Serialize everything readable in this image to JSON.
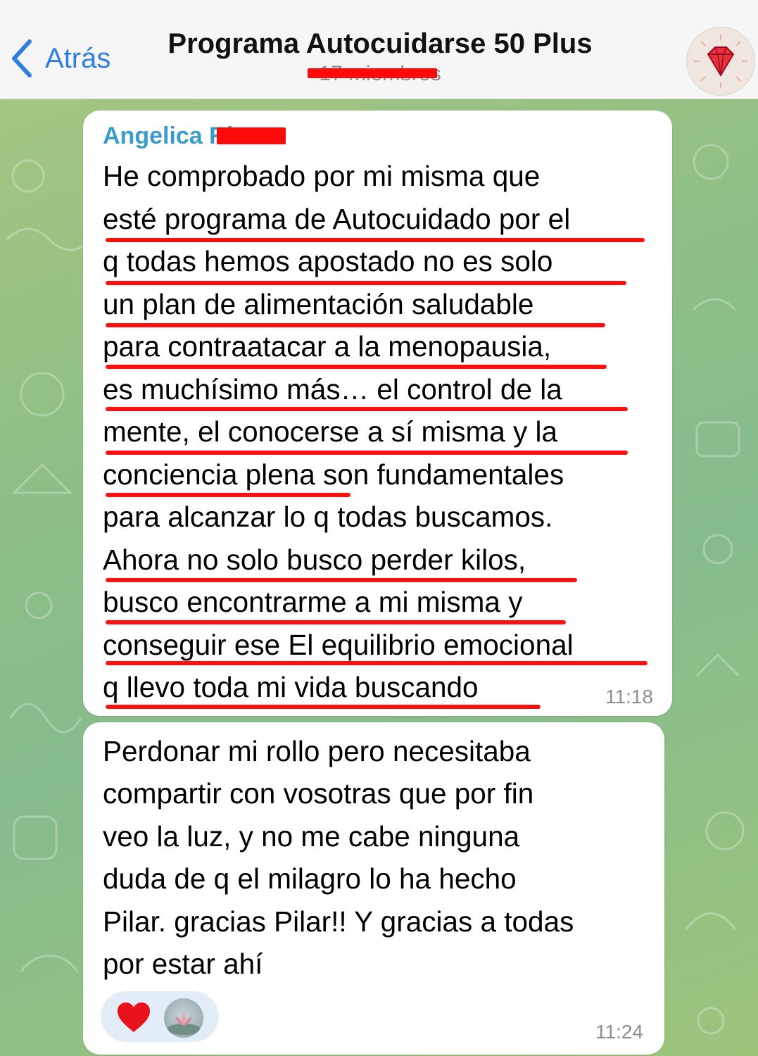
{
  "header": {
    "back_label": "Atrás",
    "title": "Programa Autocuidarse 50 Plus",
    "subtitle": "17 miembros",
    "avatar_icon": "ruby-gem-icon"
  },
  "messages": [
    {
      "sender": "Angelica Rivas",
      "lines": [
        "He comprobado por mi misma que",
        "esté programa de Autocuidado por el",
        "q todas hemos apostado no es solo",
        "un plan de alimentación saludable",
        "para contraatacar a la menopausia,",
        "es muchísimo más… el control de la",
        "mente, el conocerse a sí misma y la",
        "conciencia plena son fundamentales",
        "para alcanzar lo q todas buscamos.",
        "Ahora no solo busco perder kilos,",
        "busco encontrarme a mi misma y",
        "conseguir ese El equilibrio emocional",
        "q llevo toda mi vida buscando"
      ],
      "time": "11:18"
    },
    {
      "lines": [
        "Perdonar mi rollo pero necesitaba",
        "compartir con vosotras que por fin",
        "veo la luz, y no me cabe ninguna",
        "duda de q el milagro lo ha hecho",
        "Pilar. gracias Pilar!! Y gracias a todas",
        "por estar ahí"
      ],
      "time": "11:24",
      "reaction": {
        "icon": "red-heart-icon",
        "reactor_avatar": "lotus-photo-avatar"
      }
    }
  ],
  "colors": {
    "accent": "#2f7fe0",
    "sender_name": "#3a9cc8",
    "annotation_red": "#ff1010",
    "bubble": "#ffffff"
  }
}
